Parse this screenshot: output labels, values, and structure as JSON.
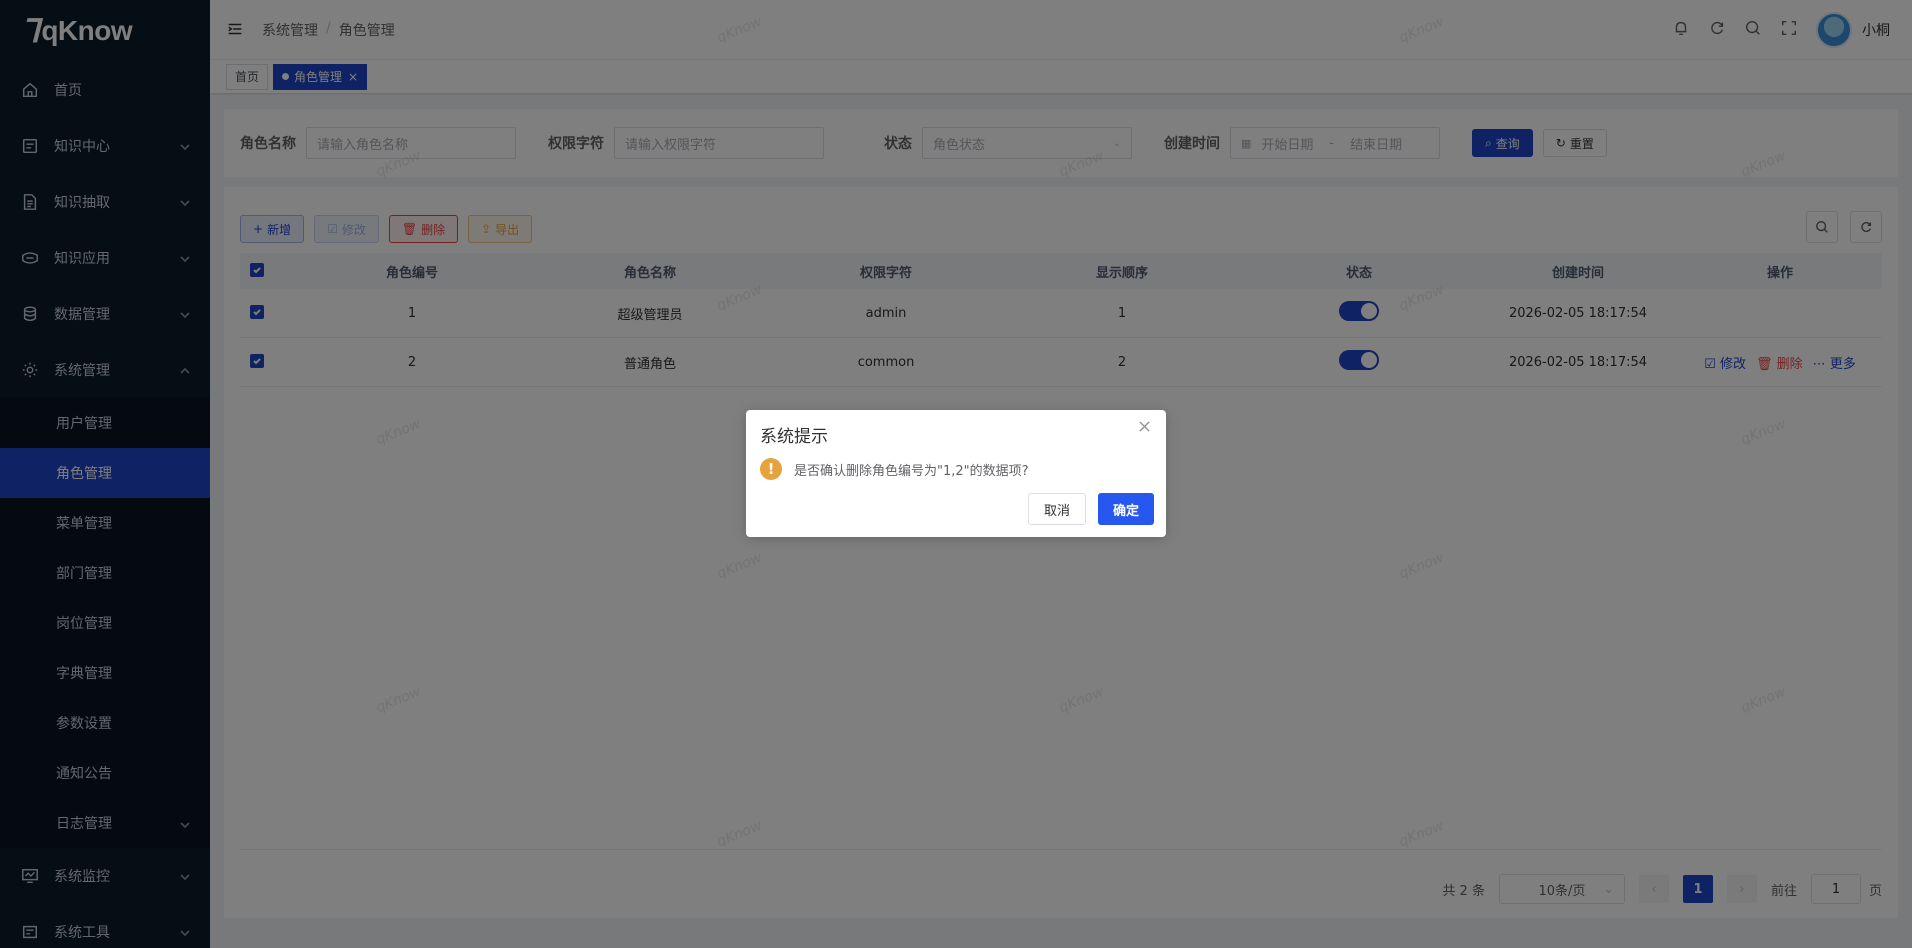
{
  "app": {
    "logo_text": "qKnow"
  },
  "sidebar": {
    "items": [
      {
        "label": "首页",
        "icon": "home-icon"
      },
      {
        "label": "知识中心",
        "icon": "book-icon"
      },
      {
        "label": "知识抽取",
        "icon": "document-icon"
      },
      {
        "label": "知识应用",
        "icon": "app-icon"
      },
      {
        "label": "数据管理",
        "icon": "database-icon"
      },
      {
        "label": "系统管理",
        "icon": "gear-icon"
      }
    ],
    "sub_items": [
      "用户管理",
      "角色管理",
      "菜单管理",
      "部门管理",
      "岗位管理",
      "字典管理",
      "参数设置",
      "通知公告",
      "日志管理"
    ],
    "bottom_items": [
      {
        "label": "系统监控",
        "icon": "monitor-icon"
      },
      {
        "label": "系统工具",
        "icon": "tool-icon"
      }
    ]
  },
  "header": {
    "breadcrumb": [
      "系统管理",
      "角色管理"
    ],
    "username": "小桐"
  },
  "tags": [
    {
      "label": "首页"
    },
    {
      "label": "角色管理"
    }
  ],
  "search": {
    "role_name_label": "角色名称",
    "role_name_placeholder": "请输入角色名称",
    "perm_label": "权限字符",
    "perm_placeholder": "请输入权限字符",
    "status_label": "状态",
    "status_placeholder": "角色状态",
    "created_label": "创建时间",
    "start_placeholder": "开始日期",
    "date_sep": "-",
    "end_placeholder": "结束日期",
    "query_btn": "查询",
    "reset_btn": "重置"
  },
  "toolbar": {
    "add": "新增",
    "edit": "修改",
    "delete": "删除",
    "export": "导出"
  },
  "table": {
    "columns": [
      "角色编号",
      "角色名称",
      "权限字符",
      "显示顺序",
      "状态",
      "创建时间",
      "操作"
    ],
    "rows": [
      {
        "id": "1",
        "name": "超级管理员",
        "key": "admin",
        "sort": "1",
        "created": "2026-02-05 18:17:54"
      },
      {
        "id": "2",
        "name": "普通角色",
        "key": "common",
        "sort": "2",
        "created": "2026-02-05 18:17:54"
      }
    ],
    "ops": {
      "edit": "修改",
      "delete": "删除",
      "more": "更多"
    }
  },
  "pagination": {
    "total": "共 2 条",
    "page_size": "10条/页",
    "current": "1",
    "goto_prefix": "前往",
    "goto_value": "1",
    "goto_suffix": "页"
  },
  "dialog": {
    "title": "系统提示",
    "message": "是否确认删除角色编号为\"1,2\"的数据项?",
    "cancel": "取消",
    "confirm": "确定"
  },
  "watermark": "qKnow",
  "colors": {
    "primary": "#1e44c8",
    "sidebar_bg": "#0b1a2b",
    "danger": "#ee4444",
    "warning": "#e6a23c"
  }
}
